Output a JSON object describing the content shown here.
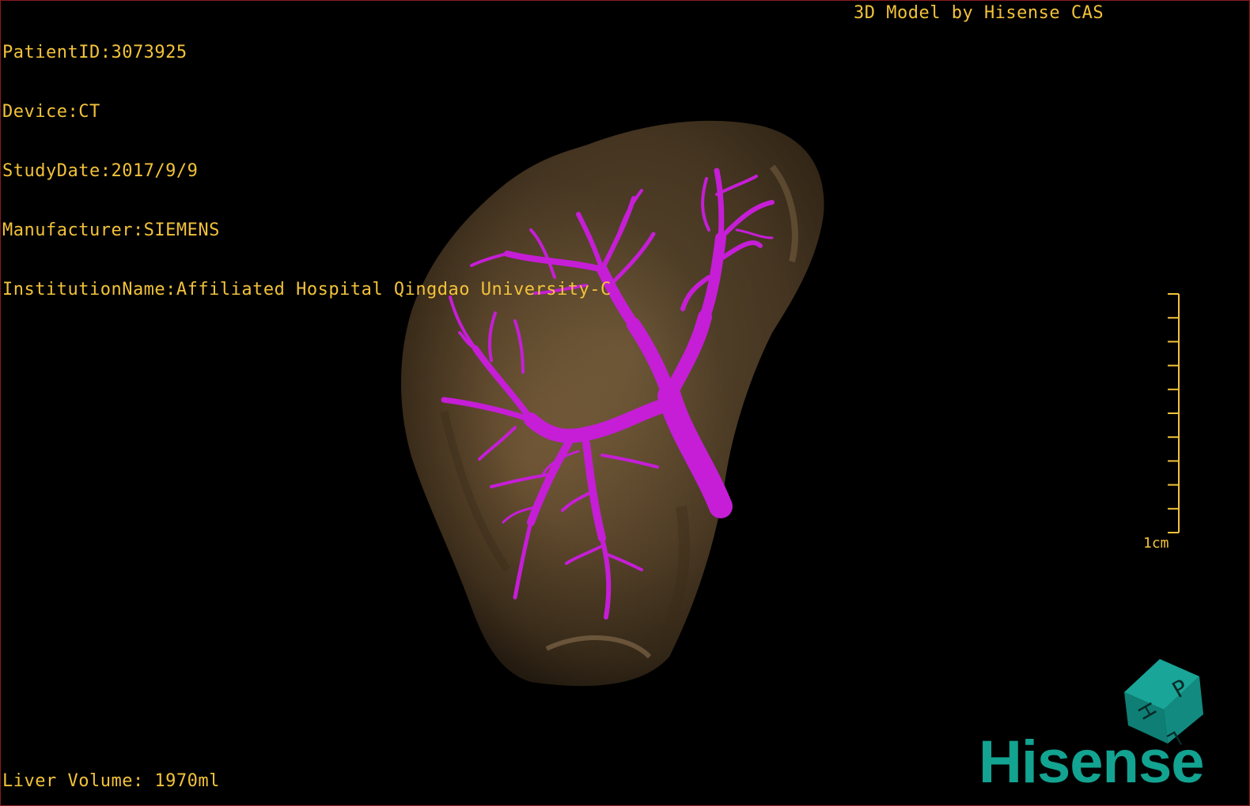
{
  "overlay": {
    "patient_id": "PatientID:3073925",
    "device": "Device:CT",
    "study_date": "StudyDate:2017/9/9",
    "manufacturer": "Manufacturer:SIEMENS",
    "institution": "InstitutionName:Affiliated Hospital Qingdao University-C",
    "model_credit": "3D Model by Hisense CAS",
    "liver_volume": "Liver Volume: 1970ml"
  },
  "scale_bar": {
    "label": "1cm",
    "tick_count": 10
  },
  "orientation_cube": {
    "faces": [
      "P",
      "L",
      "H"
    ]
  },
  "logo": {
    "text": "Hisense"
  },
  "colors": {
    "overlay_text": "#f2c23a",
    "liver": "#6b5233",
    "vessels": "#c51ed6",
    "logo": "#13a391",
    "cube": "#138a80"
  }
}
